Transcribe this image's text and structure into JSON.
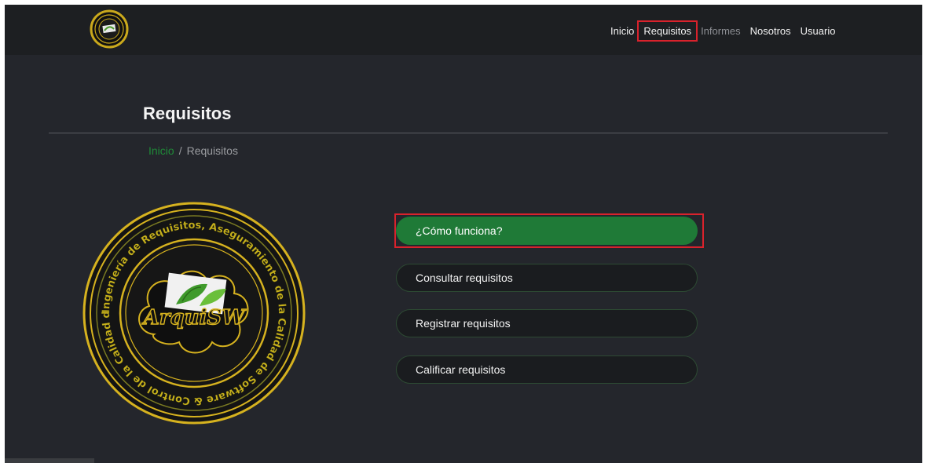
{
  "nav": {
    "links": [
      {
        "label": "Inicio",
        "state": "normal"
      },
      {
        "label": "Requisitos",
        "state": "active"
      },
      {
        "label": "Informes",
        "state": "muted"
      },
      {
        "label": "Nosotros",
        "state": "normal"
      },
      {
        "label": "Usuario",
        "state": "normal"
      }
    ]
  },
  "page": {
    "title": "Requisitos",
    "breadcrumb": {
      "home": "Inicio",
      "separator": "/",
      "current": "Requisitos"
    }
  },
  "emblem": {
    "brand_text": "ArquiSW",
    "ring_text": "Ingeniería de Requisitos, Aseguramiento de la Calidad de Software & Control de la Calidad de Software"
  },
  "actions": [
    {
      "label": "¿Cómo funciona?"
    },
    {
      "label": "Consultar requisitos"
    },
    {
      "label": "Registrar requisitos"
    },
    {
      "label": "Calificar requisitos"
    }
  ],
  "colors": {
    "accent": "#1f7a37",
    "highlight": "#d9222c",
    "emblem_gold": "#d6b21f"
  }
}
